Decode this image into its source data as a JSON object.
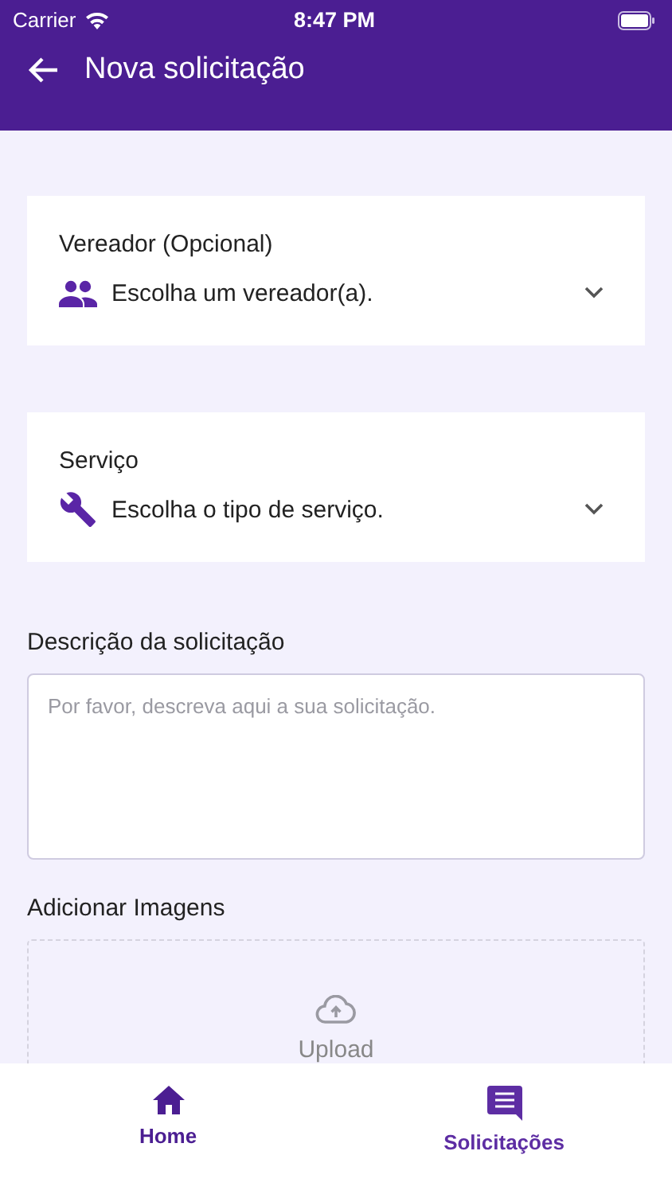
{
  "status_bar": {
    "carrier": "Carrier",
    "time": "8:47 PM"
  },
  "header": {
    "title": "Nova solicitação"
  },
  "selects": [
    {
      "label": "Vereador (Opcional)",
      "kind": "people",
      "value": "Escolha um vereador(a)."
    },
    {
      "label": "Serviço",
      "kind": "wrench",
      "value": "Escolha o tipo de serviço."
    }
  ],
  "description": {
    "label": "Descrição da solicitação",
    "placeholder": "Por favor, descreva aqui a sua solicitação."
  },
  "images": {
    "label": "Adicionar Imagens",
    "button": "Upload"
  },
  "tab_bar": [
    {
      "label": "Home",
      "kind": "home",
      "selected": false
    },
    {
      "label": "Solicitações",
      "kind": "chat",
      "selected": true
    }
  ]
}
